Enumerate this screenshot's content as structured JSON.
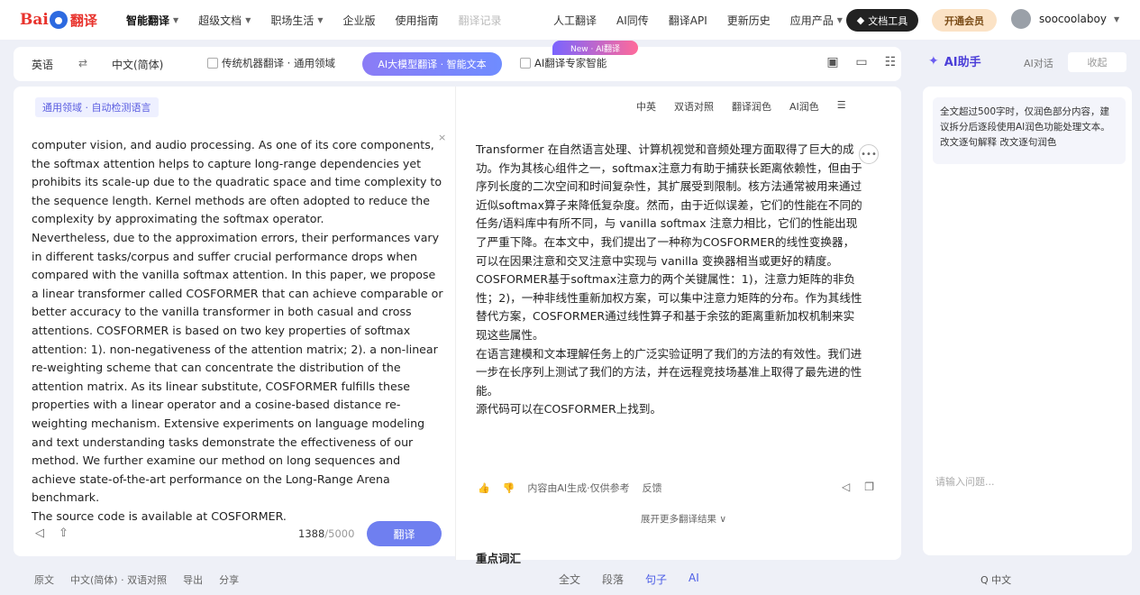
{
  "nav": {
    "logo_left": "Bai",
    "logo_right": "翻译",
    "items": [
      {
        "label": "智能翻译",
        "active": true,
        "dropdown": true
      },
      {
        "label": "超级文档",
        "dropdown": true
      },
      {
        "label": "职场生活",
        "dropdown": true
      },
      {
        "label": "企业版"
      },
      {
        "label": "使用指南"
      },
      {
        "label": "翻译记录"
      }
    ],
    "right_items": [
      {
        "label": "人工翻译"
      },
      {
        "label": "AI同传"
      },
      {
        "label": "翻译API"
      },
      {
        "label": "更新历史"
      },
      {
        "label": "应用产品",
        "dropdown": true
      }
    ],
    "doc_tool": "文档工具",
    "vip": "开通会员",
    "username": "soocoolaboy"
  },
  "langbar": {
    "source": "英语",
    "swap": "⇄",
    "target": "中文(简体)",
    "general_check": "传统机器翻译 · 通用领域",
    "mode": "AI大模型翻译 · 智能文本",
    "ai_check": "AI翻译专家智能",
    "new_badge": "New · AI翻译"
  },
  "ai_panel": {
    "title": "AI助手",
    "tab2": "AI对话",
    "close": "收起",
    "message": "全文超过500字时，仅润色部分内容，建议拆分后逐段使用AI润色功能处理文本。 改文逐句解释 改文逐句润色",
    "input_placeholder": "请输入问题..."
  },
  "source": {
    "tag": "通用领域 · 自动检测语言",
    "close": "×",
    "text": "computer vision, and audio processing. As one of its core components, the softmax attention helps to capture long-range dependencies yet prohibits its scale-up due to the quadratic space and time complexity to the sequence length. Kernel methods are often adopted to reduce the complexity by approximating the softmax operator.\nNevertheless, due to the approximation errors, their performances vary in different tasks/corpus and suffer crucial performance drops when compared with the vanilla softmax attention. In this paper, we propose a linear transformer called COSFORMER that can achieve comparable or better accuracy to the vanilla transformer in both casual and cross attentions. COSFORMER is based on two key properties of softmax attention: 1). non-negativeness of the attention matrix; 2). a non-linear re-weighting scheme that can concentrate the distribution of the attention matrix. As its linear substitute, COSFORMER fulfills these properties with a linear operator and a cosine-based distance re-weighting mechanism. Extensive experiments on language modeling and text understanding tasks demonstrate the effectiveness of our method. We further examine our method on long sequences and achieve state-of-the-art performance on the Long-Range Arena benchmark.\nThe source code is available at COSFORMER.",
    "count": "1388",
    "max": "/5000",
    "translate": "翻译"
  },
  "target": {
    "tools": [
      "中英",
      "双语对照",
      "翻译润色",
      "AI润色"
    ],
    "side_icon": "•••",
    "text": "Transformer 在自然语言处理、计算机视觉和音频处理方面取得了巨大的成功。作为其核心组件之一，softmax注意力有助于捕获长距离依赖性，但由于序列长度的二次空间和时间复杂性，其扩展受到限制。核方法通常被用来通过近似softmax算子来降低复杂度。然而，由于近似误差，它们的性能在不同的任务/语料库中有所不同，与 vanilla softmax 注意力相比，它们的性能出现了严重下降。在本文中，我们提出了一种称为COSFORMER的线性变换器，可以在因果注意和交叉注意中实现与 vanilla 变换器相当或更好的精度。COSFORMER基于softmax注意力的两个关键属性：1)，注意力矩阵的非负性；2)，一种非线性重新加权方案，可以集中注意力矩阵的分布。作为其线性替代方案，COSFORMER通过线性算子和基于余弦的距离重新加权机制来实现这些属性。\n在语言建模和文本理解任务上的广泛实验证明了我们的方法的有效性。我们进一步在长序列上测试了我们的方法，并在远程竞技场基准上取得了最先进的性能。\n源代码可以在COSFORMER上找到。",
    "action_label": "内容由AI生成·仅供参考",
    "action_label2": "反馈",
    "expand": "展开更多翻译结果 ∨",
    "keywords": "重点词汇"
  },
  "bottombar": {
    "left": [
      "原文",
      "中文(简体) · 双语对照",
      "导出",
      "分享"
    ],
    "mid": [
      "全文",
      "段落",
      "句子",
      "AI"
    ],
    "right": "Q 中文"
  }
}
